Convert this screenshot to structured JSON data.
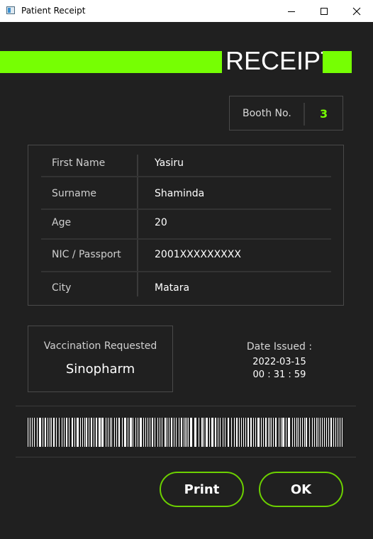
{
  "window": {
    "title": "Patient Receipt"
  },
  "header": {
    "title": "RECEIPT"
  },
  "booth": {
    "label": "Booth No.",
    "number": "3"
  },
  "patient": [
    {
      "label": "First Name",
      "value": "Yasiru"
    },
    {
      "label": "Surname",
      "value": "Shaminda"
    },
    {
      "label": "Age",
      "value": "20"
    },
    {
      "label": "NIC / Passport",
      "value": "2001XXXXXXXXX"
    },
    {
      "label": "City",
      "value": "Matara"
    }
  ],
  "vaccination": {
    "label": "Vaccination Requested",
    "value": "Sinopharm"
  },
  "date_issued": {
    "label": "Date Issued :",
    "date": "2022-03-15",
    "time": "00 : 31 : 59"
  },
  "buttons": {
    "print": "Print",
    "ok": "OK"
  },
  "colors": {
    "accent": "#76ff03",
    "background": "#202020",
    "button_border": "#6cd000"
  },
  "icons": [
    "app-icon",
    "minimize-icon",
    "maximize-icon",
    "close-icon",
    "barcode"
  ]
}
